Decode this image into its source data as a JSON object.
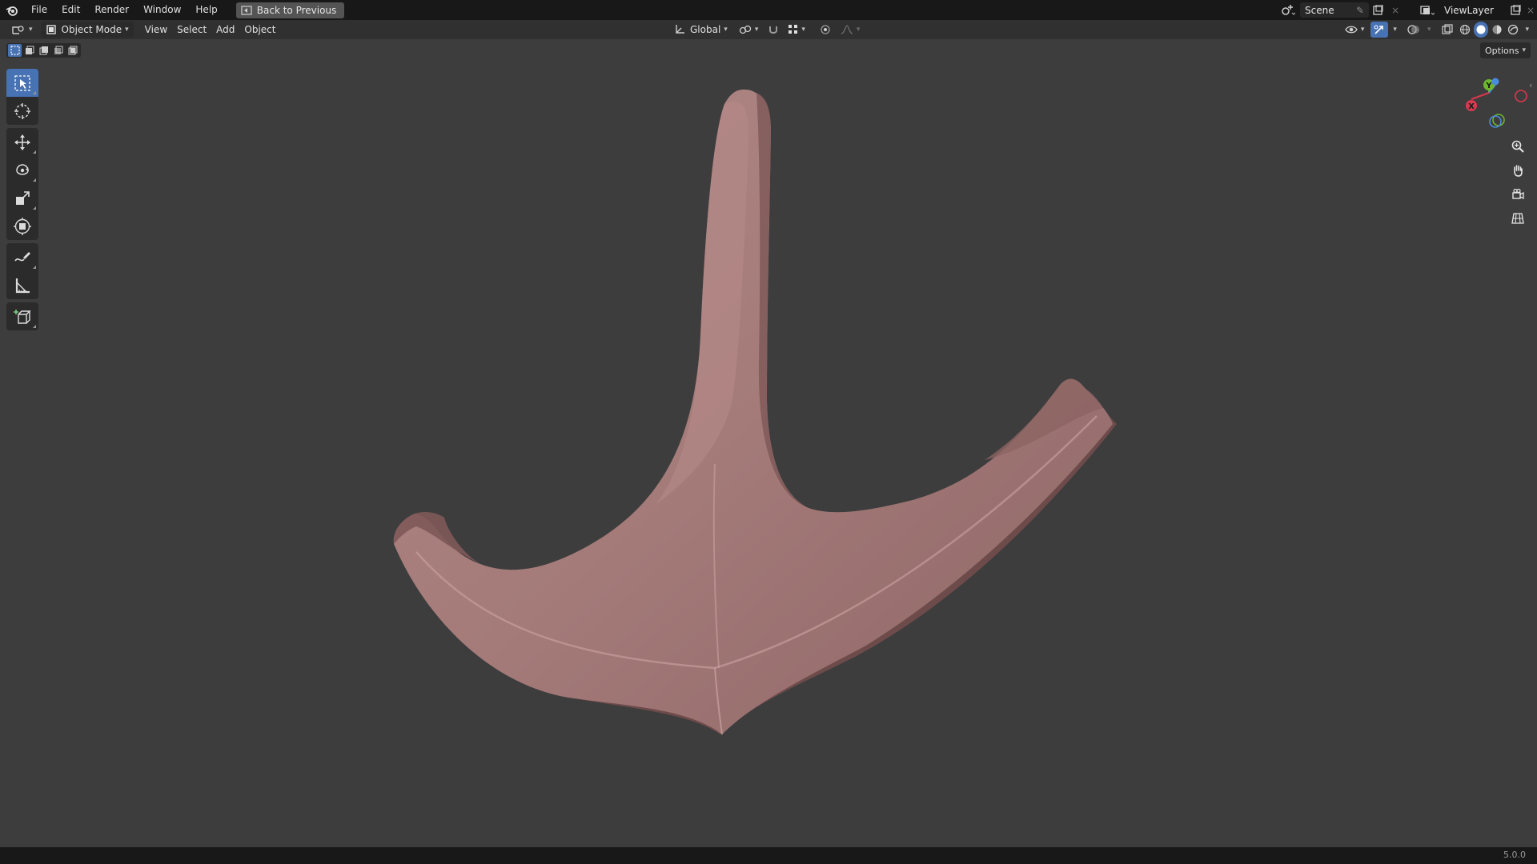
{
  "topbar": {
    "menus": [
      "File",
      "Edit",
      "Render",
      "Window",
      "Help"
    ],
    "back_label": "Back to Previous",
    "scene_label": "Scene",
    "view_layer_label": "ViewLayer"
  },
  "header": {
    "mode_label": "Object Mode",
    "menus": [
      "View",
      "Select",
      "Add",
      "Object"
    ],
    "orientation_label": "Global"
  },
  "viewport": {
    "options_label": "Options",
    "gizmo": {
      "y_label": "Y",
      "x_label": "X"
    }
  },
  "toolbar": {
    "tools": [
      "select-box",
      "cursor",
      "move",
      "rotate",
      "scale",
      "transform",
      "annotate",
      "measure",
      "add-cube"
    ]
  },
  "status": {
    "version": "5.0.0"
  },
  "colors": {
    "accent": "#4772b3",
    "model": "#a37a78",
    "background": "#3d3d3d"
  }
}
